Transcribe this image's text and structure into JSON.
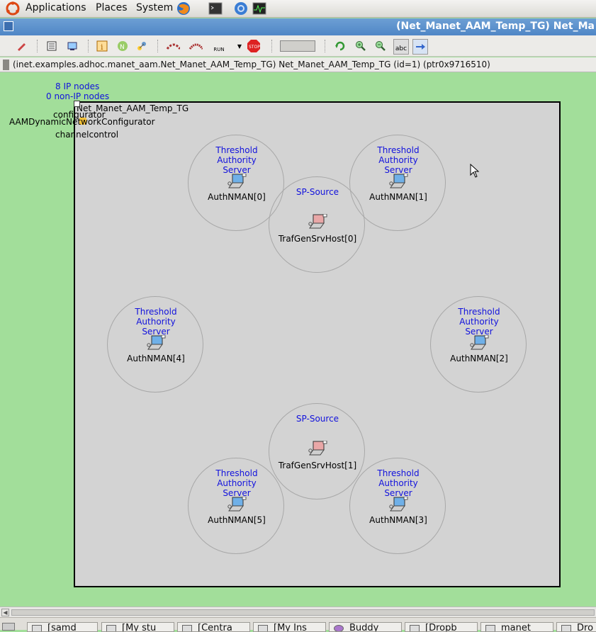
{
  "top_panel": {
    "menus": [
      "Applications",
      "Places",
      "System"
    ]
  },
  "window": {
    "title": "(Net_Manet_AAM_Temp_TG) Net_Ma"
  },
  "infobar": {
    "text": "(inet.examples.adhoc.manet_aam.Net_Manet_AAM_Temp_TG) Net_Manet_AAM_Temp_TG  (id=1)  (ptr0x9716510)"
  },
  "canvas": {
    "ip_nodes": "8 IP nodes",
    "non_ip_nodes": "0 non-IP nodes",
    "network_name": "Net_Manet_AAM_Temp_TG",
    "configurator": "configurator",
    "configurator_type": "AAMDynamicNetworkConfigurator",
    "channelcontrol": "channelcontrol",
    "nodes": [
      {
        "label": [
          "Threshold",
          "Authority",
          "Server"
        ],
        "name": "AuthNMAN[0]",
        "kind": "laptop-blue"
      },
      {
        "label": [
          "Threshold",
          "Authority",
          "Server"
        ],
        "name": "AuthNMAN[1]",
        "kind": "laptop-blue"
      },
      {
        "label": [
          "SP-Source"
        ],
        "name": "TrafGenSrvHost[0]",
        "kind": "laptop-red"
      },
      {
        "label": [
          "Threshold",
          "Authority",
          "Server"
        ],
        "name": "AuthNMAN[4]",
        "kind": "laptop-blue"
      },
      {
        "label": [
          "Threshold",
          "Authority",
          "Server"
        ],
        "name": "AuthNMAN[2]",
        "kind": "laptop-blue"
      },
      {
        "label": [
          "SP-Source"
        ],
        "name": "TrafGenSrvHost[1]",
        "kind": "laptop-red"
      },
      {
        "label": [
          "Threshold",
          "Authority",
          "Server"
        ],
        "name": "AuthNMAN[5]",
        "kind": "laptop-blue"
      },
      {
        "label": [
          "Threshold",
          "Authority",
          "Server"
        ],
        "name": "AuthNMAN[3]",
        "kind": "laptop-blue"
      }
    ]
  },
  "taskbar": {
    "items": [
      "[samd",
      "[My stu",
      "[Centra",
      "[My Ins",
      "Buddy",
      "[Dropb",
      "manet",
      "Dro"
    ]
  },
  "toolbar": {
    "run_label": "RUN",
    "stop_label": "STOP",
    "abc_label": "abc"
  },
  "colors": {
    "canvas_bg": "#a2de9a",
    "network_bg": "#d3d3d3",
    "node_label": "#1111dd"
  }
}
